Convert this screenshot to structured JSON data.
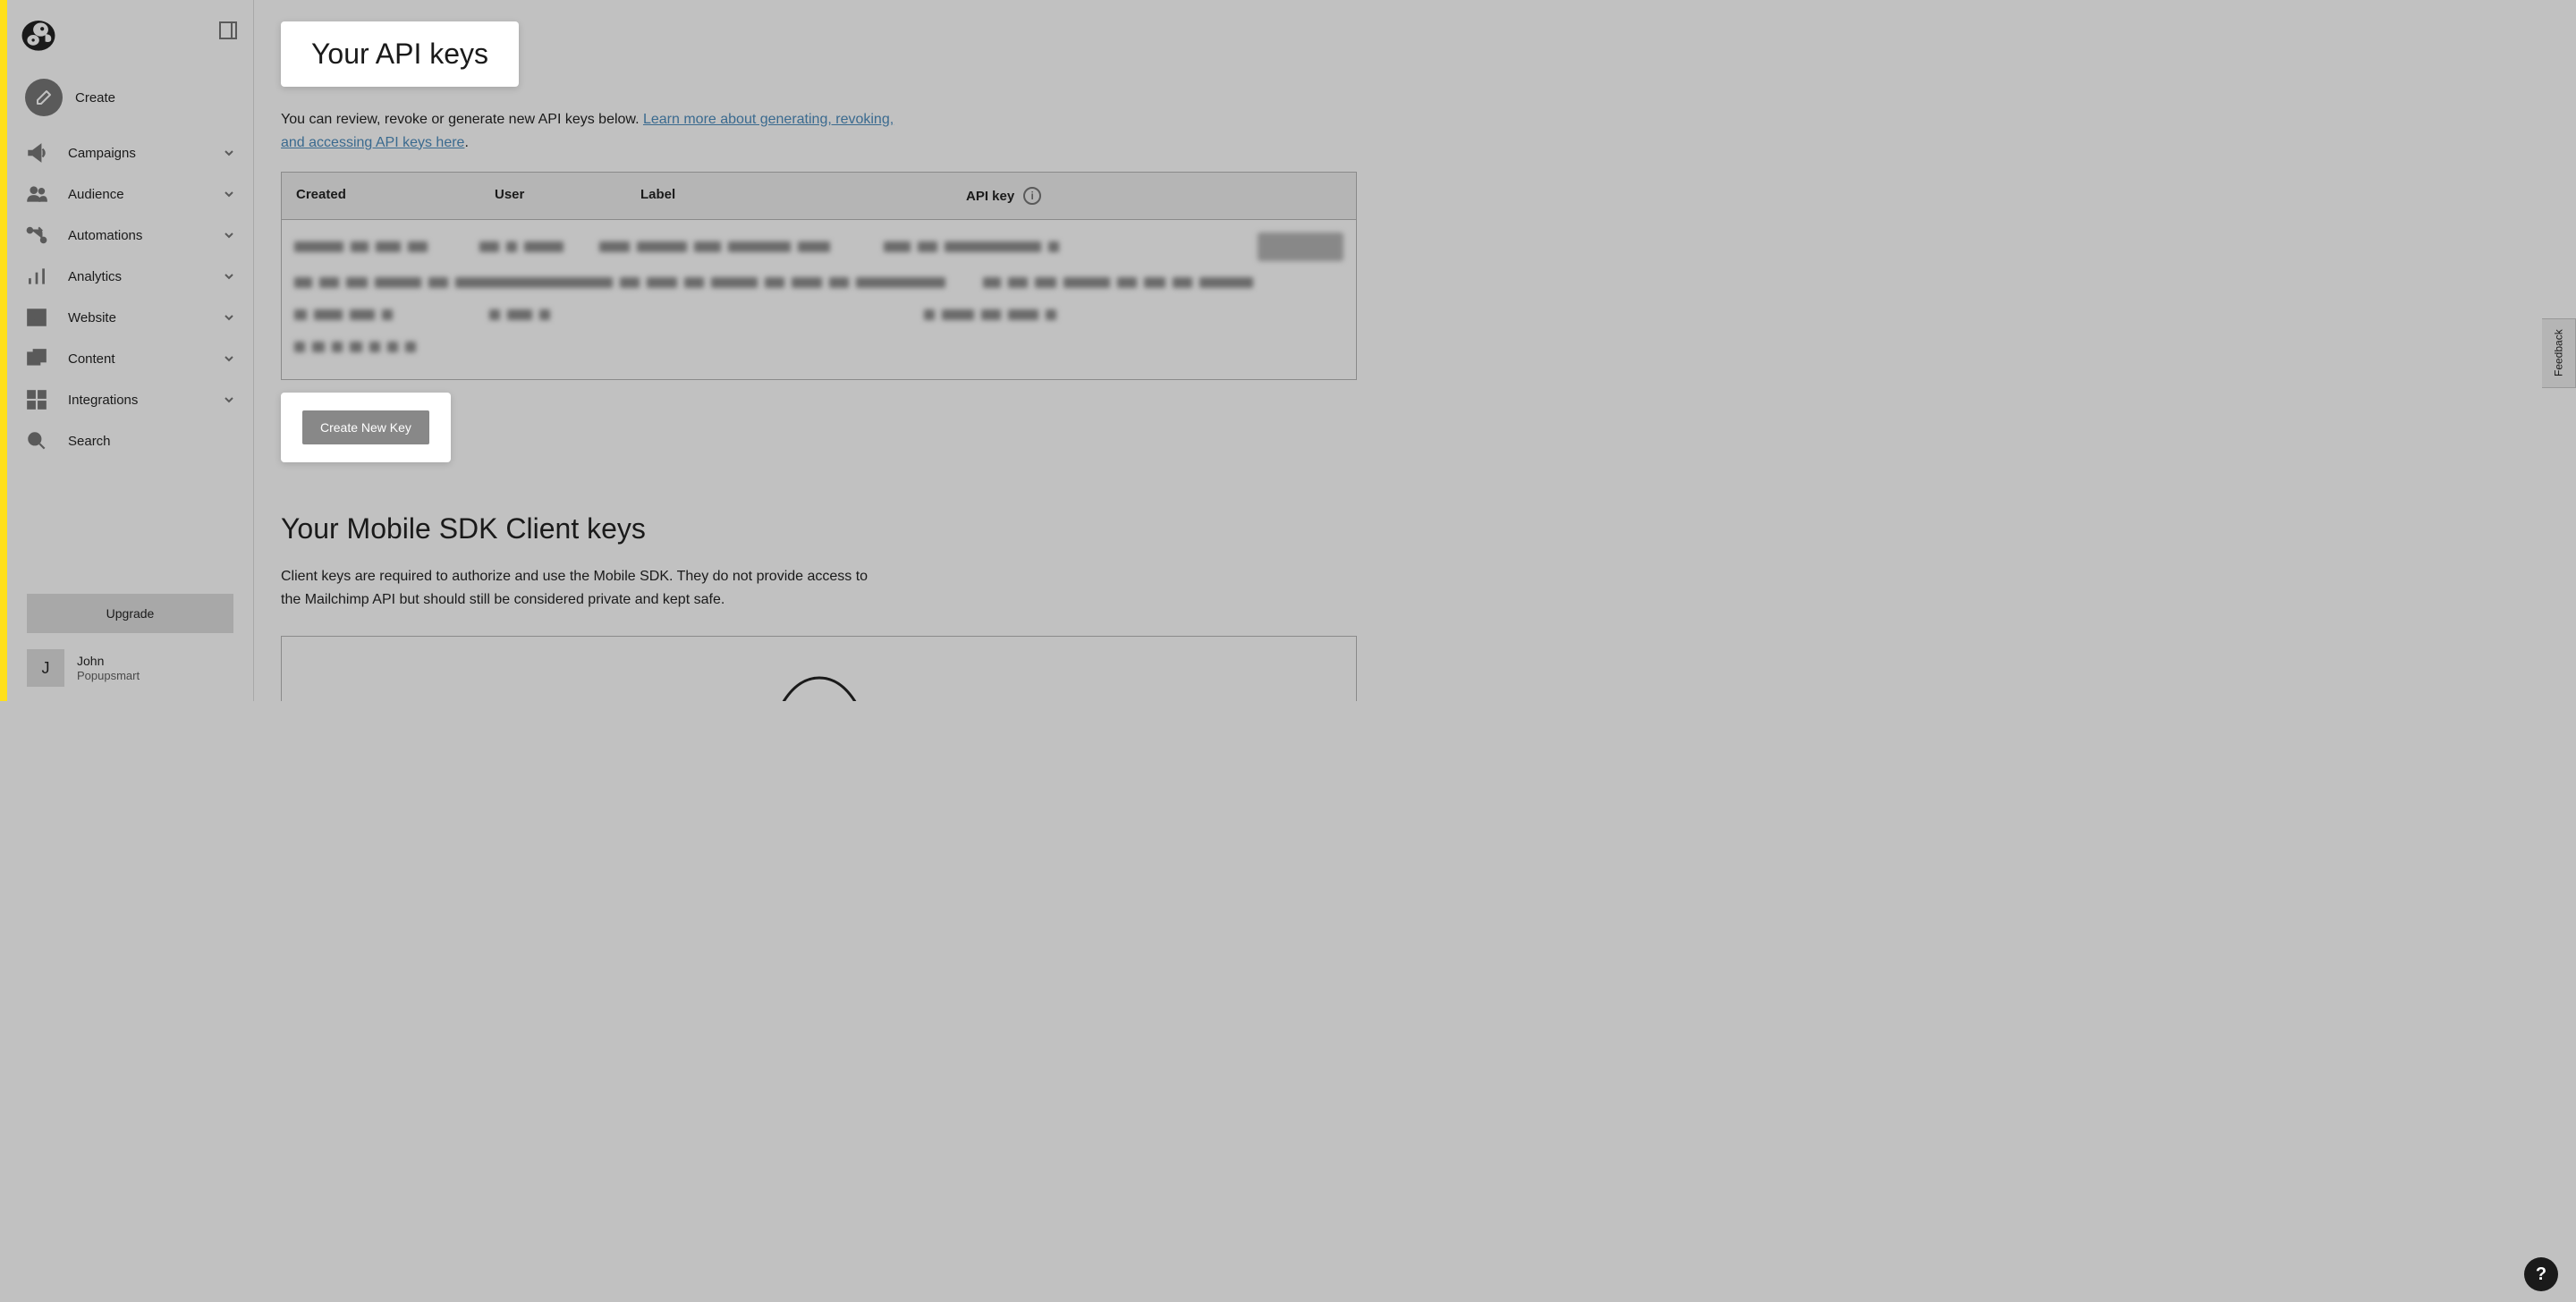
{
  "sidebar": {
    "create": "Create",
    "items": [
      {
        "label": "Campaigns"
      },
      {
        "label": "Audience"
      },
      {
        "label": "Automations"
      },
      {
        "label": "Analytics"
      },
      {
        "label": "Website"
      },
      {
        "label": "Content"
      },
      {
        "label": "Integrations"
      },
      {
        "label": "Search"
      }
    ],
    "upgrade": "Upgrade",
    "user": {
      "initial": "J",
      "name": "John",
      "org": "Popupsmart"
    }
  },
  "main": {
    "title": "Your API keys",
    "description_text": "You can review, revoke or generate new API keys below. ",
    "description_link": "Learn more about generating, revoking, and accessing API keys here",
    "description_end": ".",
    "table": {
      "headers": {
        "created": "Created",
        "user": "User",
        "label": "Label",
        "apikey": "API key"
      }
    },
    "create_btn": "Create New Key",
    "sdk_title": "Your Mobile SDK Client keys",
    "sdk_desc": "Client keys are required to authorize and use the Mobile SDK. They do not provide access to the Mailchimp API but should still be considered private and kept safe."
  },
  "feedback": "Feedback",
  "help": "?"
}
